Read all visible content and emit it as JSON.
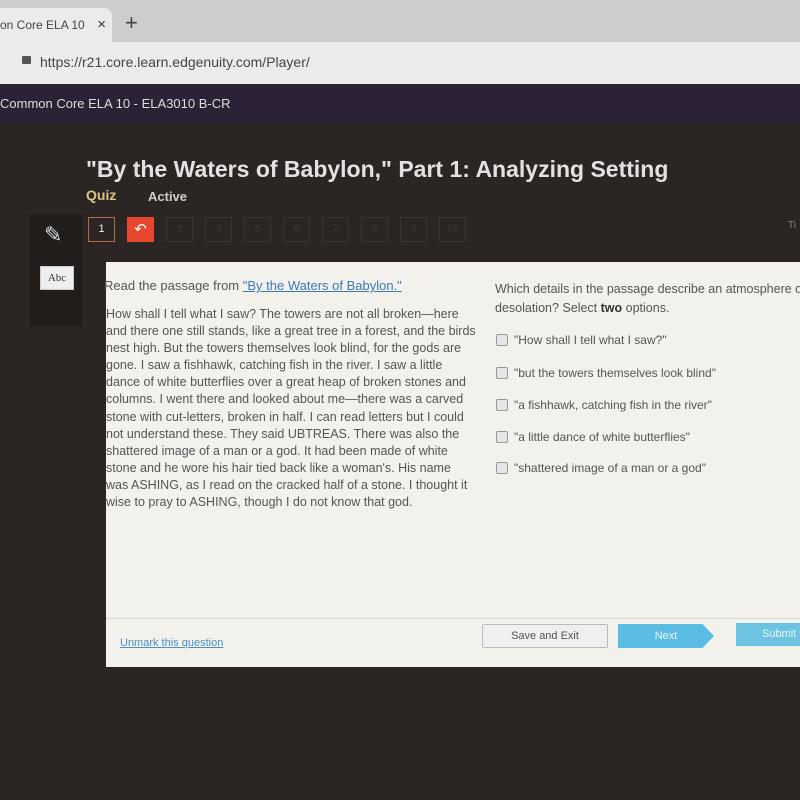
{
  "browser": {
    "tab_title": "on Core ELA 10",
    "tab_close": "×",
    "new_tab": "+",
    "url": "https://r21.core.learn.edgenuity.com/Player/"
  },
  "course": "Common Core ELA 10 - ELA3010 B-CR",
  "header": {
    "title": "\"By the Waters of Babylon,\" Part 1: Analyzing Setting",
    "quiz_label": "Quiz",
    "status": "Active",
    "truncated_right": "Ti"
  },
  "tools": {
    "pencil_icon": "✎",
    "abc_icon": "Abc"
  },
  "question_nav": [
    {
      "label": "1",
      "state": "current"
    },
    {
      "label": "↶",
      "state": "flagged"
    },
    {
      "label": "3"
    },
    {
      "label": "4"
    },
    {
      "label": "5"
    },
    {
      "label": "6"
    },
    {
      "label": "7"
    },
    {
      "label": "8"
    },
    {
      "label": "9"
    },
    {
      "label": "10"
    }
  ],
  "passage": {
    "intro": "Read the passage from ",
    "link": "\"By the Waters of Babylon.\"",
    "text": "How shall I tell what I saw? The towers are not all broken—here and there one still stands, like a great tree in a forest, and the birds nest high. But the towers themselves look blind, for the gods are gone. I saw a fishhawk, catching fish in the river. I saw a little dance of white butterflies over a great heap of broken stones and columns. I went there and looked about me—there was a carved stone with cut-letters, broken in half. I can read letters but I could not understand these. They said UBTREAS. There was also the shattered image of a man or a god. It had been made of white stone and he wore his hair tied back like a woman's. His name was ASHING, as I read on the cracked half of a stone. I thought it wise to pray to ASHING, though I do not know that god."
  },
  "question": {
    "text_a": "Which details in the passage describe an atmosphere of desolation? Select ",
    "bold": "two",
    "text_b": " options.",
    "options": [
      "\"How shall I tell what I saw?\"",
      "\"but the towers themselves look blind\"",
      "\"a fishhawk, catching fish in the river\"",
      "\"a little dance of white butterflies\"",
      "\"shattered image of a man or a god\""
    ]
  },
  "footer": {
    "unmark": "Unmark this question",
    "save": "Save and Exit",
    "next": "Next",
    "submit": "Submit"
  },
  "colors": {
    "accent": "#5bbde3",
    "flag": "#e8472f",
    "course_bar": "#2d2136"
  }
}
